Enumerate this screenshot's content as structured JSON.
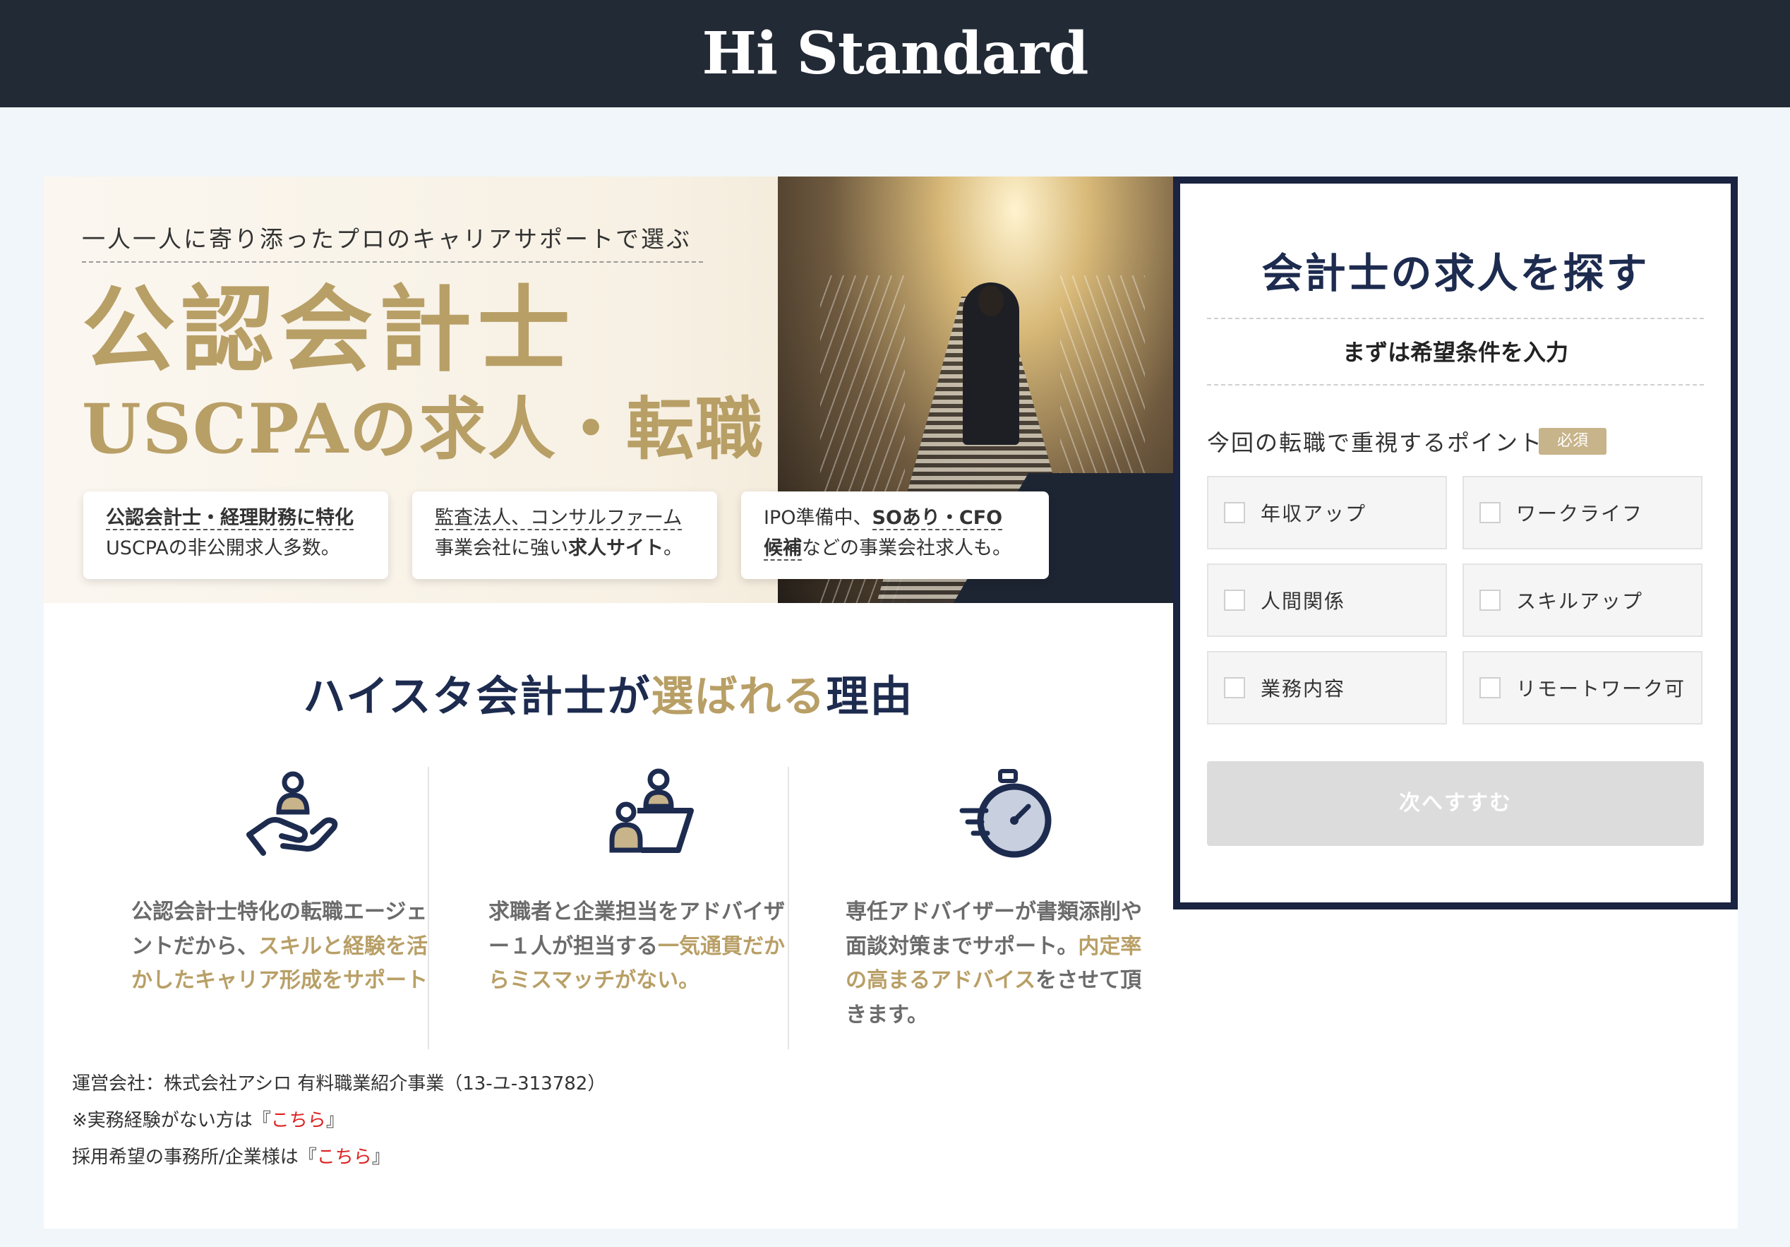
{
  "header": {
    "logo": "Hi Standard"
  },
  "hero": {
    "kicker": "一人一人に寄り添ったプロのキャリアサポートで選ぶ",
    "title_line1": "公認会計士",
    "title_line2": "USCPAの求人・転職",
    "box1": {
      "line1": "公認会計士・経理財務に特化",
      "line2": "USCPAの非公開求人多数。"
    },
    "box2": {
      "line1": "監査法人、コンサルファーム",
      "line2a": "事業会社に強い",
      "line2b": "求人サイト",
      "line2c": "。"
    },
    "box3": {
      "line1a": "IPO準備中、",
      "line1b": "SOあり・CFO",
      "line2a": "候補",
      "line2b": "などの事業会社求人も。"
    }
  },
  "reasons": {
    "title_a": "ハイスタ会計士が",
    "title_b": "選ばれる",
    "title_c": "理由",
    "items": [
      {
        "icon": "hand-person-icon",
        "text_plain": "公認会計士特化の転職エージェントだから、",
        "text_gold": "スキルと経験を活かしたキャリア形成をサポート",
        "text_tail": ""
      },
      {
        "icon": "advisor-meeting-icon",
        "text_plain": "求職者と企業担当をアドバイザー１人が担当する",
        "text_gold": "一気通貫だからミスマッチがない。",
        "text_tail": ""
      },
      {
        "icon": "stopwatch-icon",
        "text_plain": "専任アドバイザーが書類添削や面談対策までサポート。",
        "text_gold": "内定率の高まるアドバイス",
        "text_tail": "をさせて頂きます。"
      }
    ]
  },
  "footer": {
    "company": "運営会社：株式会社アシロ 有料職業紹介事業（13-ユ-313782）",
    "line2_pre": "※実務経験がない方は『",
    "line2_link": "こちら",
    "line2_post": "』",
    "line3_pre": "採用希望の事務所/企業様は『",
    "line3_link": "こちら",
    "line3_post": "』"
  },
  "form": {
    "title": "会計士の求人を探す",
    "subtitle": "まずは希望条件を入力",
    "question": "今回の転職で重視するポイント",
    "required_badge": "必須",
    "options": [
      "年収アップ",
      "ワークライフ",
      "人間関係",
      "スキルアップ",
      "業務内容",
      "リモートワーク可"
    ],
    "next_button": "次へすすむ"
  },
  "colors": {
    "navy": "#1d2b4f",
    "gold": "#b89f66",
    "header_bg": "#222a36",
    "link_red": "#dd2222"
  }
}
